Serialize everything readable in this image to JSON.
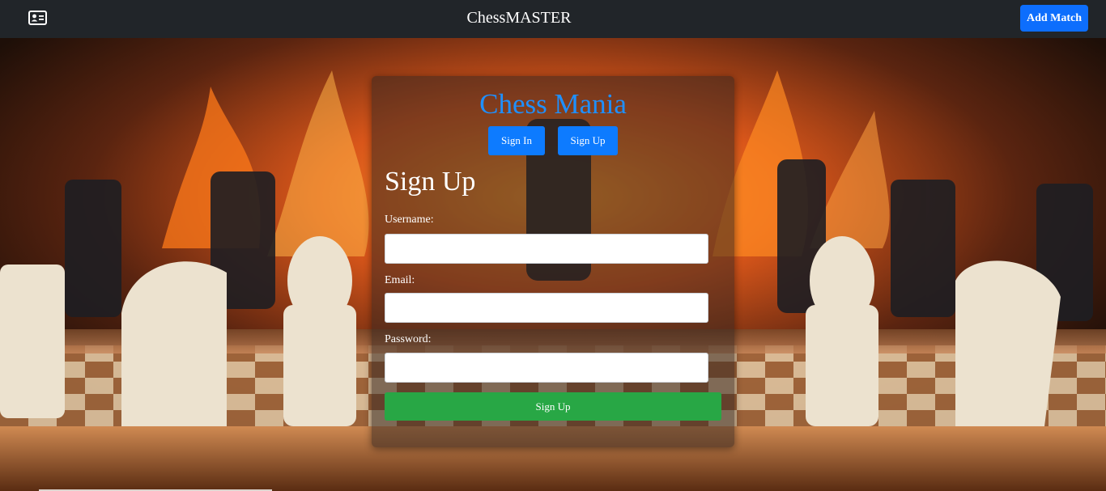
{
  "navbar": {
    "brand": "ChessMASTER",
    "icon": "id-card-icon",
    "add_match_label": "Add Match"
  },
  "card": {
    "title": "Chess Mania",
    "tabs": [
      {
        "label": "Sign In"
      },
      {
        "label": "Sign Up"
      }
    ],
    "heading": "Sign Up",
    "fields": [
      {
        "label": "Username:",
        "value": ""
      },
      {
        "label": "Email:",
        "value": ""
      },
      {
        "label": "Password:",
        "value": ""
      }
    ],
    "submit_label": "Sign Up"
  },
  "colors": {
    "navbar": "#212529",
    "primary": "#0d6efd",
    "title": "#1e90ff",
    "success": "#28a745"
  }
}
